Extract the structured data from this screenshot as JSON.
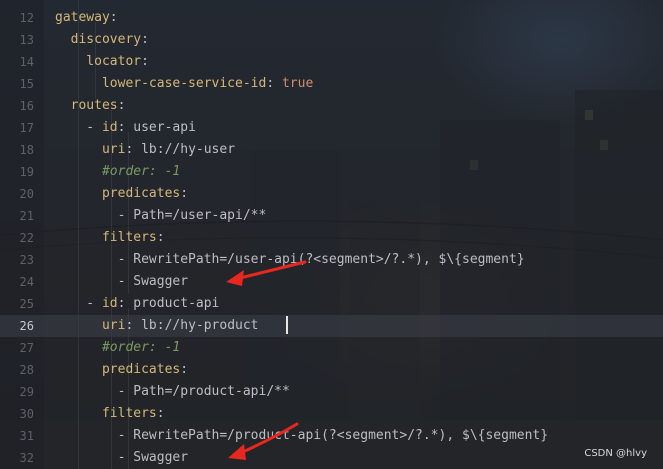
{
  "editor": {
    "lines": [
      {
        "num": "12",
        "segments": [
          {
            "t": "gateway",
            "c": "k"
          },
          {
            "t": ":",
            "c": "v"
          }
        ]
      },
      {
        "num": "13",
        "segments": [
          {
            "t": "  discovery",
            "c": "k"
          },
          {
            "t": ":",
            "c": "v"
          }
        ]
      },
      {
        "num": "14",
        "segments": [
          {
            "t": "    locator",
            "c": "k"
          },
          {
            "t": ":",
            "c": "v"
          }
        ]
      },
      {
        "num": "15",
        "segments": [
          {
            "t": "      lower-case-service-id",
            "c": "k"
          },
          {
            "t": ": ",
            "c": "v"
          },
          {
            "t": "true",
            "c": "b"
          }
        ]
      },
      {
        "num": "16",
        "segments": [
          {
            "t": "  routes",
            "c": "k"
          },
          {
            "t": ":",
            "c": "v"
          }
        ]
      },
      {
        "num": "17",
        "segments": [
          {
            "t": "    - ",
            "c": "d"
          },
          {
            "t": "id",
            "c": "k"
          },
          {
            "t": ": user-api",
            "c": "v"
          }
        ]
      },
      {
        "num": "18",
        "segments": [
          {
            "t": "      uri",
            "c": "k"
          },
          {
            "t": ": lb://hy-user",
            "c": "v"
          }
        ]
      },
      {
        "num": "19",
        "segments": [
          {
            "t": "      #order: -1",
            "c": "c"
          }
        ]
      },
      {
        "num": "20",
        "segments": [
          {
            "t": "      predicates",
            "c": "k"
          },
          {
            "t": ":",
            "c": "v"
          }
        ]
      },
      {
        "num": "21",
        "segments": [
          {
            "t": "        - Path=/user-api/**",
            "c": "v"
          }
        ]
      },
      {
        "num": "22",
        "segments": [
          {
            "t": "      filters",
            "c": "k"
          },
          {
            "t": ":",
            "c": "v"
          }
        ]
      },
      {
        "num": "23",
        "segments": [
          {
            "t": "        - RewritePath=/user-api(?<segment>/?.*), $\\{segment}",
            "c": "v"
          }
        ]
      },
      {
        "num": "24",
        "segments": [
          {
            "t": "        - Swagger",
            "c": "v"
          }
        ]
      },
      {
        "num": "25",
        "segments": [
          {
            "t": "    - ",
            "c": "d"
          },
          {
            "t": "id",
            "c": "k"
          },
          {
            "t": ": product-api",
            "c": "v"
          }
        ]
      },
      {
        "num": "26",
        "segments": [
          {
            "t": "      uri",
            "c": "k"
          },
          {
            "t": ": lb://hy-product",
            "c": "v"
          }
        ],
        "current": true
      },
      {
        "num": "27",
        "segments": [
          {
            "t": "      #order: -1",
            "c": "c"
          }
        ]
      },
      {
        "num": "28",
        "segments": [
          {
            "t": "      predicates",
            "c": "k"
          },
          {
            "t": ":",
            "c": "v"
          }
        ]
      },
      {
        "num": "29",
        "segments": [
          {
            "t": "        - Path=/product-api/**",
            "c": "v"
          }
        ]
      },
      {
        "num": "30",
        "segments": [
          {
            "t": "      filters",
            "c": "k"
          },
          {
            "t": ":",
            "c": "v"
          }
        ]
      },
      {
        "num": "31",
        "segments": [
          {
            "t": "        - RewritePath=/product-api(?<segment>/?.*), $\\{segment}",
            "c": "v"
          }
        ]
      },
      {
        "num": "32",
        "segments": [
          {
            "t": "        - Swagger",
            "c": "v"
          }
        ]
      }
    ]
  },
  "annotations": {
    "arrow_color": "#e8271f"
  },
  "watermark": "CSDN @hlvy",
  "colors": {
    "key": "#d5b778",
    "boolean": "#cf8e6d",
    "comment": "#7a9a63",
    "text": "#bcbec4",
    "caret": "#e6e6e6"
  }
}
